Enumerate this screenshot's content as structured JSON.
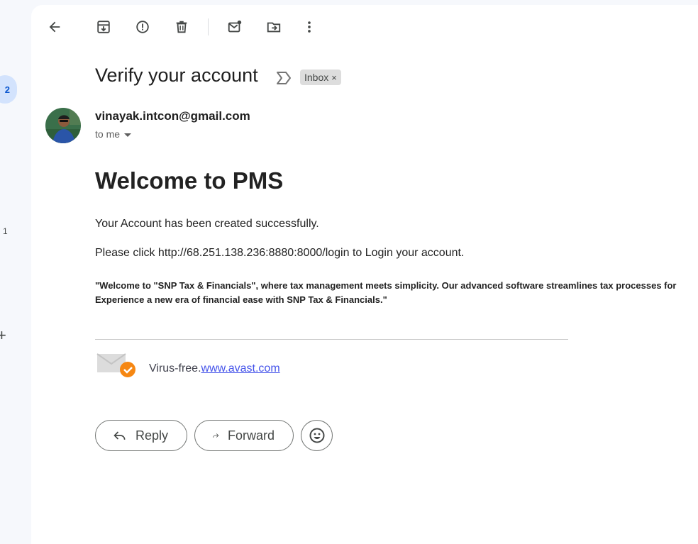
{
  "rail": {
    "badge": "2",
    "count": "1",
    "plus": "+"
  },
  "toolbar": {
    "icons": [
      "back-arrow-icon",
      "archive-icon",
      "report-spam-icon",
      "delete-icon",
      "mark-unread-icon",
      "move-to-icon",
      "more-vert-icon"
    ]
  },
  "email": {
    "subject": "Verify your account",
    "label": "Inbox",
    "label_remove": "×",
    "sender": "vinayak.intcon@gmail.com",
    "recipient": "to me",
    "heading": "Welcome to PMS",
    "line1": "Your Account has been created successfully.",
    "line2": "Please click http://68.251.138.236:8880:8000/login to Login your account.",
    "quote_line1": "\"Welcome to \"SNP Tax & Financials\", where tax management meets simplicity. Our advanced software streamlines tax processes for",
    "quote_line2": "Experience a new era of financial ease with SNP Tax & Financials.\"",
    "virus_free_text": "Virus-free.",
    "avast_link": "www.avast.com"
  },
  "actions": {
    "reply": "Reply",
    "forward": "Forward"
  },
  "colors": {
    "accent": "#0b57d0",
    "badge_bg": "#d3e3fd",
    "link": "#4453ea",
    "avast_orange": "#f68712"
  }
}
